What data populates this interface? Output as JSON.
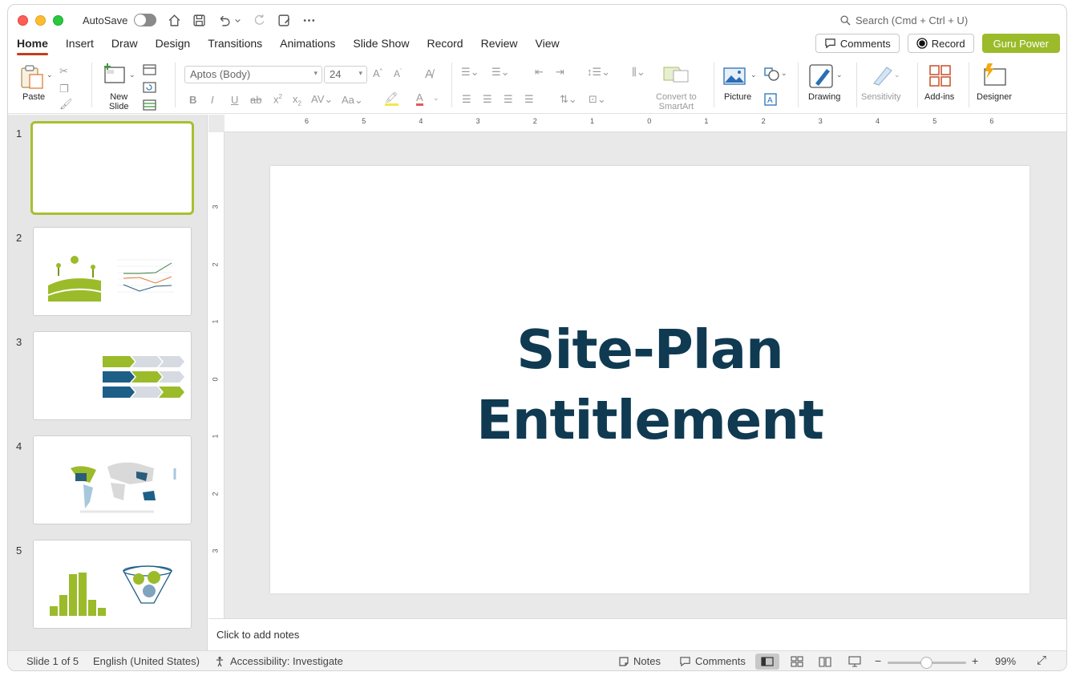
{
  "app": {
    "autosave_label": "AutoSave",
    "search_placeholder": "Search (Cmd + Ctrl + U)"
  },
  "tabs": [
    "Home",
    "Insert",
    "Draw",
    "Design",
    "Transitions",
    "Animations",
    "Slide Show",
    "Record",
    "Review",
    "View"
  ],
  "active_tab": "Home",
  "header_buttons": {
    "comments": "Comments",
    "record": "Record",
    "guru": "Guru Power"
  },
  "ribbon": {
    "paste": "Paste",
    "new_slide": "New\nSlide",
    "font_name": "Aptos (Body)",
    "font_size": "24",
    "convert_smartart": "Convert to\nSmartArt",
    "picture": "Picture",
    "drawing": "Drawing",
    "sensitivity": "Sensitivity",
    "addins": "Add-ins",
    "designer": "Designer"
  },
  "slides": [
    {
      "number": "1",
      "selected": true
    },
    {
      "number": "2",
      "selected": false
    },
    {
      "number": "3",
      "selected": false
    },
    {
      "number": "4",
      "selected": false
    },
    {
      "number": "5",
      "selected": false
    }
  ],
  "slide_content": {
    "title_line1": "Site-Plan",
    "title_line2": "Entitlement",
    "title_color": "#0f3a52"
  },
  "ruler": {
    "horizontal": [
      "6",
      "5",
      "4",
      "3",
      "2",
      "1",
      "0",
      "1",
      "2",
      "3",
      "4",
      "5",
      "6"
    ],
    "vertical": [
      "3",
      "2",
      "1",
      "0",
      "1",
      "2",
      "3"
    ]
  },
  "notes_placeholder": "Click to add notes",
  "status": {
    "slide_info": "Slide 1 of 5",
    "language": "English (United States)",
    "accessibility": "Accessibility: Investigate",
    "notes": "Notes",
    "comments": "Comments",
    "zoom": "99%"
  },
  "colors": {
    "accent_green": "#9bbb2a",
    "active_tab_underline": "#c43e1c",
    "thumb_selection": "#a8bf2f"
  }
}
